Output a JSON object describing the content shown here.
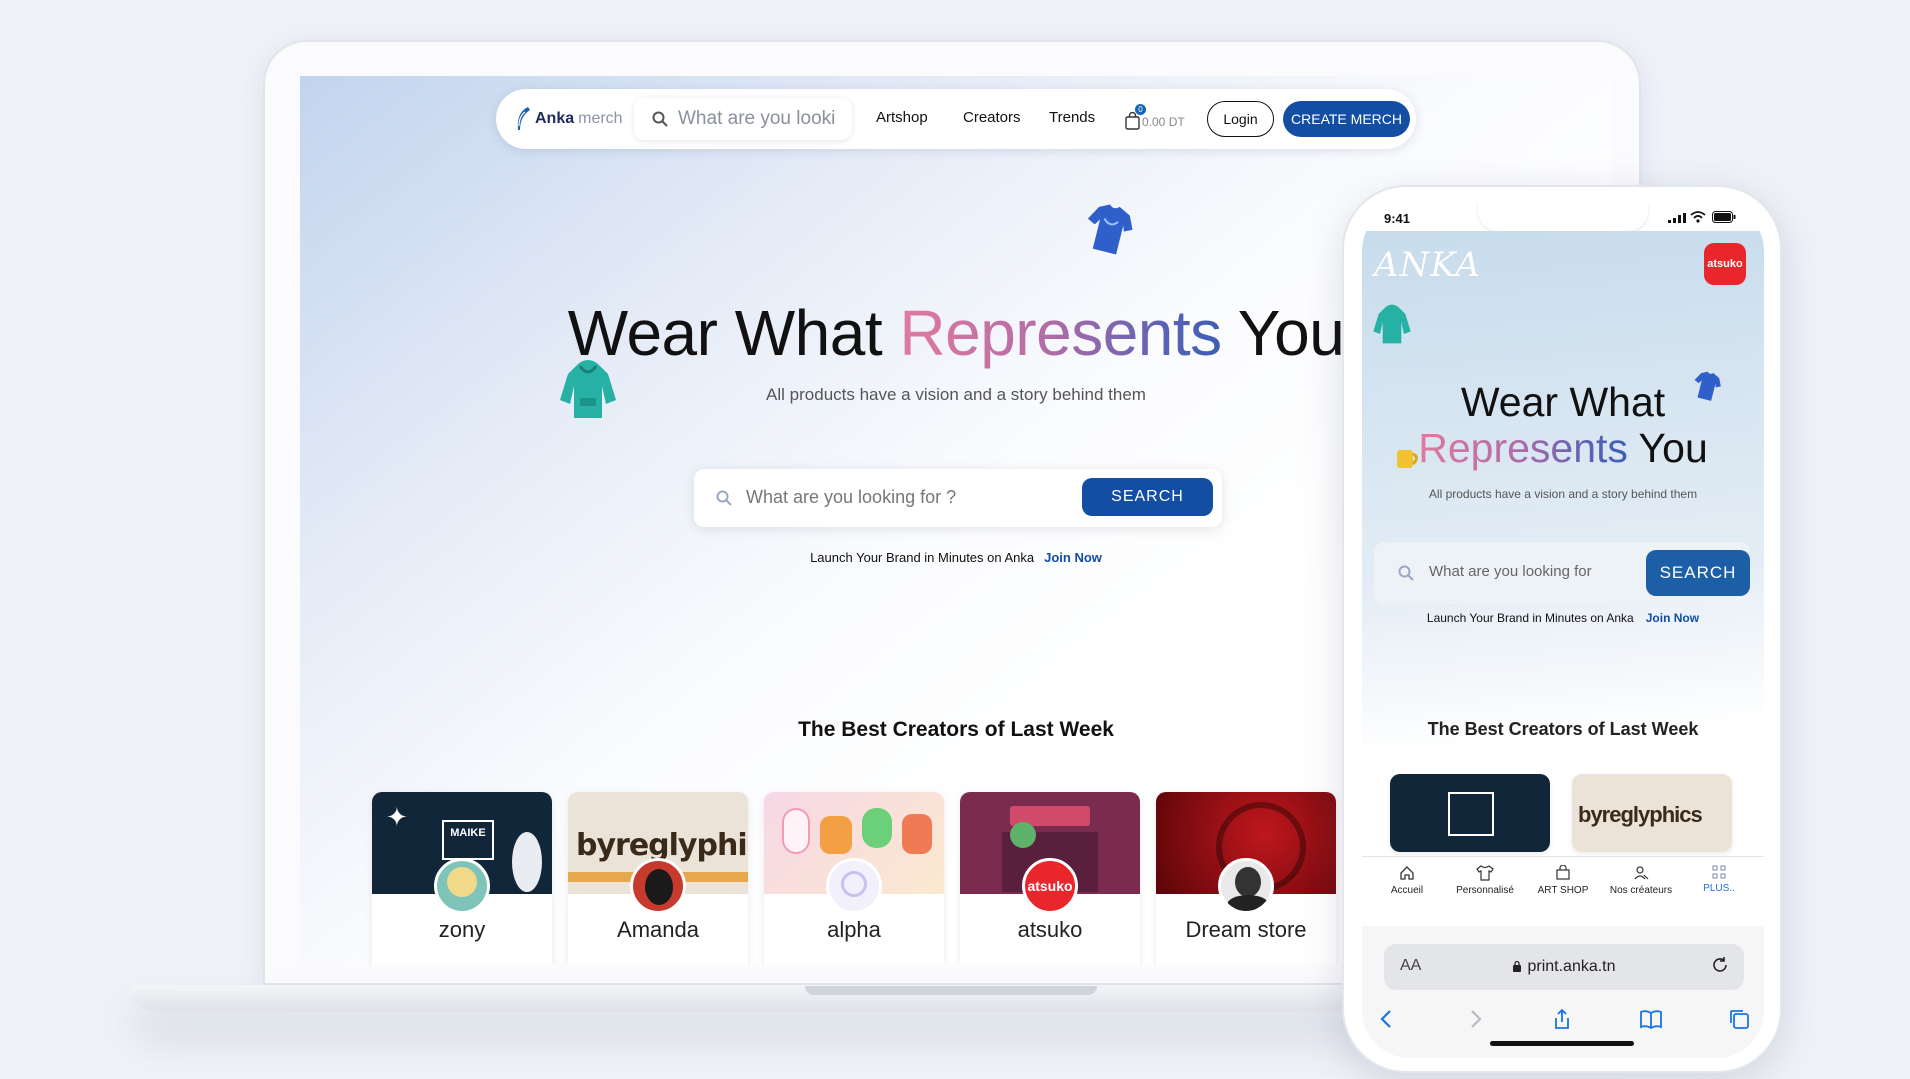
{
  "brand": {
    "name": "Anka",
    "suffix": "merch",
    "accent": "#134ea3"
  },
  "desktop": {
    "nav": {
      "search_placeholder": "What are you looki",
      "links": [
        "Artshop",
        "Creators",
        "Trends"
      ],
      "cart_count": "0",
      "cart_amount": "0.00 DT",
      "login_label": "Login",
      "create_label": "CREATE MERCH"
    },
    "hero": {
      "title_start": "Wear What ",
      "title_highlight": "Represents",
      "title_end": " You",
      "subtitle": "All products have a vision and a story behind them",
      "search_placeholder": "What are you looking for ?",
      "search_button": "SEARCH",
      "launch_text": "Launch Your Brand in Minutes on Anka",
      "join_label": "Join Now"
    },
    "section_title": "The Best Creators of Last Week",
    "creators": [
      {
        "name": "zony"
      },
      {
        "name": "Amanda"
      },
      {
        "name": "alpha"
      },
      {
        "name": "atsuko"
      },
      {
        "name": "Dream store"
      }
    ]
  },
  "mobile": {
    "time": "9:41",
    "logo": "ANKA",
    "avatar_label": "atsuko",
    "title_line1": "Wear What",
    "title_highlight": "Represents",
    "title_end": " You",
    "subtitle": "All products have a vision and a story behind them",
    "search_placeholder": "What are you looking for",
    "search_button": "SEARCH",
    "launch_text": "Launch Your Brand in Minutes on Anka",
    "join_label": "Join Now",
    "section_title": "The Best Creators of Last Week",
    "tabs": [
      {
        "label": "Accueil",
        "icon": "home-icon"
      },
      {
        "label": "Personnalisé",
        "icon": "tshirt-icon"
      },
      {
        "label": "ART SHOP",
        "icon": "shop-icon"
      },
      {
        "label": "Nos créateurs",
        "icon": "creators-icon"
      },
      {
        "label": "PLUS..",
        "icon": "grid-icon"
      }
    ],
    "browser": {
      "aa": "AA",
      "domain": "print.anka.tn"
    }
  }
}
